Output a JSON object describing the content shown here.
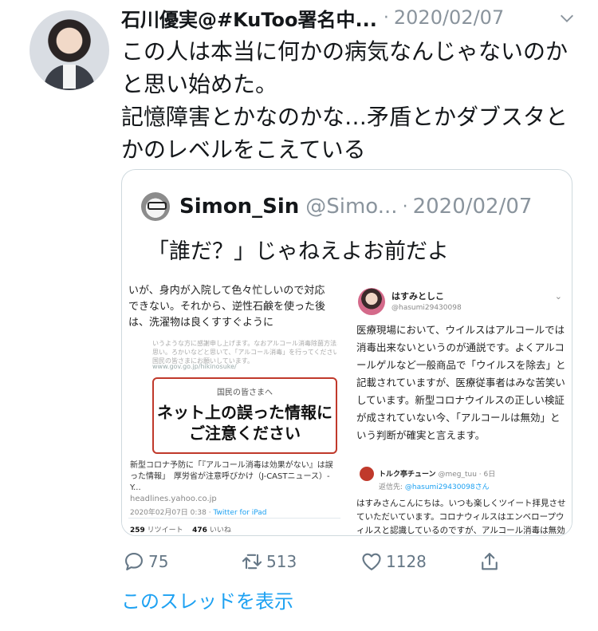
{
  "tweet": {
    "author": "石川優実@#KuToo署名中...",
    "separator": "·",
    "date": "2020/02/07",
    "text_lines": [
      "この人は本当に何かの病気なんじゃないのか",
      "と思い始めた。",
      "記憶障害とかなのかな…矛盾とかダブスタと",
      "かのレベルをこえている"
    ]
  },
  "quote": {
    "author": "Simon_Sin",
    "handle": "@Simo...",
    "separator": "·",
    "date": "2020/02/07",
    "text": "「誰だ？」じゃねえよお前だよ",
    "image_left": {
      "lines": [
        "いが、身内が入院して色々忙しいので対応",
        "できない。それから、逆性石鹸を使った後",
        "は、洗濯物は良くすすぐように"
      ],
      "blurred_lines": [
        "いうような方に感謝申し上げます。なおアルコール消毒除菌方法、",
        "思い。ろかいなどと思いて、「アルコール消毒」を行ってくださいよう、",
        "国民の皆さまにお願いしています。"
      ],
      "url": "www.gov.go.jp/hikinosuke/",
      "notice_sub": "国民の皆さまへ",
      "notice_main_1": "ネット上の誤った情報に",
      "notice_main_2": "ご注意ください",
      "link_title": "新型コロナ予防に「『アルコール消毒は効果がない』は誤った情報」　厚労省が注意呼びかけ（J-CASTニュース）- Y...",
      "link_host": "headlines.yahoo.co.jp",
      "timestamp": "2020年02月07日 0:38",
      "via": "Twitter for iPad",
      "retweets_count": "259",
      "retweets_label": "リツイート",
      "likes_count": "476",
      "likes_label": "いいね"
    },
    "image_right": {
      "name": "はすみとしこ",
      "handle": "@hasumi29430098",
      "text": "医療現場において、ウイルスはアルコールでは消毒出来ないというのが通説です。よくアルコールゲルなど一般商品で「ウイルスを除去」と記載されていますが、医療従事者はみな苦笑いしています。新型コロナウイルスの正しい検証が成されていない今、「アルコールは無効」という判断が確実と言えます。",
      "reply_name": "トルク亭チューン",
      "reply_handle": "@meg_tuu · 6日",
      "reply_to_label": "返信先:",
      "reply_to_mention": "@hasumi29430098さん",
      "reply_text": "はすみさんこんにちは。いつも楽しくツイート拝見させていただいています。コロナウィルスはエンベロープウィルスと認識しているのですが、アルコール消毒は無効でしょうか？"
    }
  },
  "actions": {
    "reply_count": "75",
    "retweet_count": "513",
    "like_count": "1128"
  },
  "thread_link": "このスレッドを表示",
  "colors": {
    "link": "#1da1f2",
    "muted": "#8a949d",
    "text": "#14171a",
    "border": "#cfd9de"
  },
  "icons": [
    "chevron-down-icon",
    "reply-icon",
    "retweet-icon",
    "like-icon",
    "share-icon"
  ]
}
